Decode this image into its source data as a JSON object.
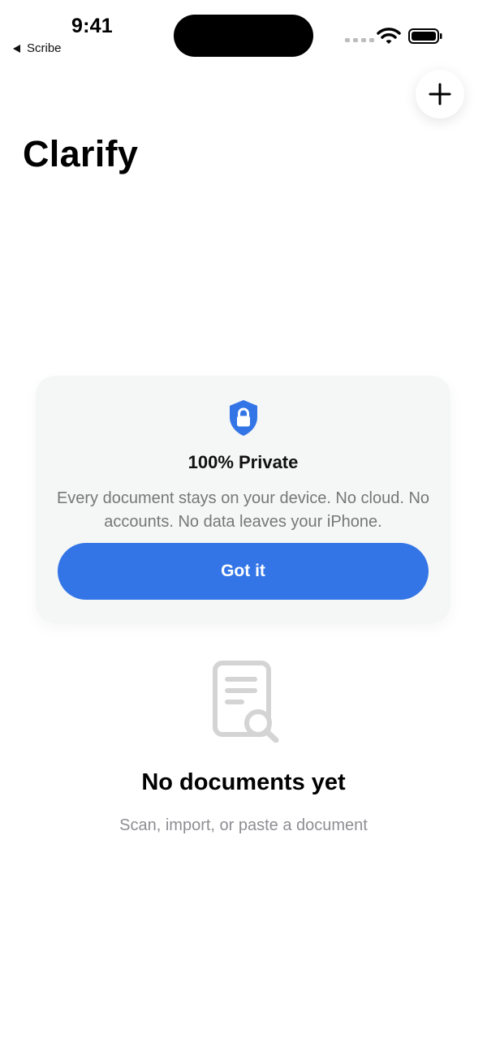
{
  "status_bar": {
    "time": "9:41",
    "back_app": "Scribe",
    "back_icon": "back-triangle-icon",
    "wifi_icon": "wifi-icon",
    "battery_icon": "battery-icon",
    "signal_icon": "signal-dots-icon"
  },
  "header": {
    "title": "Clarify",
    "add_icon": "plus-icon"
  },
  "privacy_card": {
    "icon": "shield-lock-icon",
    "title": "100% Private",
    "text": "Every document stays on your device. No cloud. No accounts. No data leaves your iPhone.",
    "button_label": "Got it",
    "accent_color": "#3375e6"
  },
  "empty_state": {
    "icon": "document-search-icon",
    "title": "No documents yet",
    "subtitle": "Scan, import, or paste a document"
  }
}
